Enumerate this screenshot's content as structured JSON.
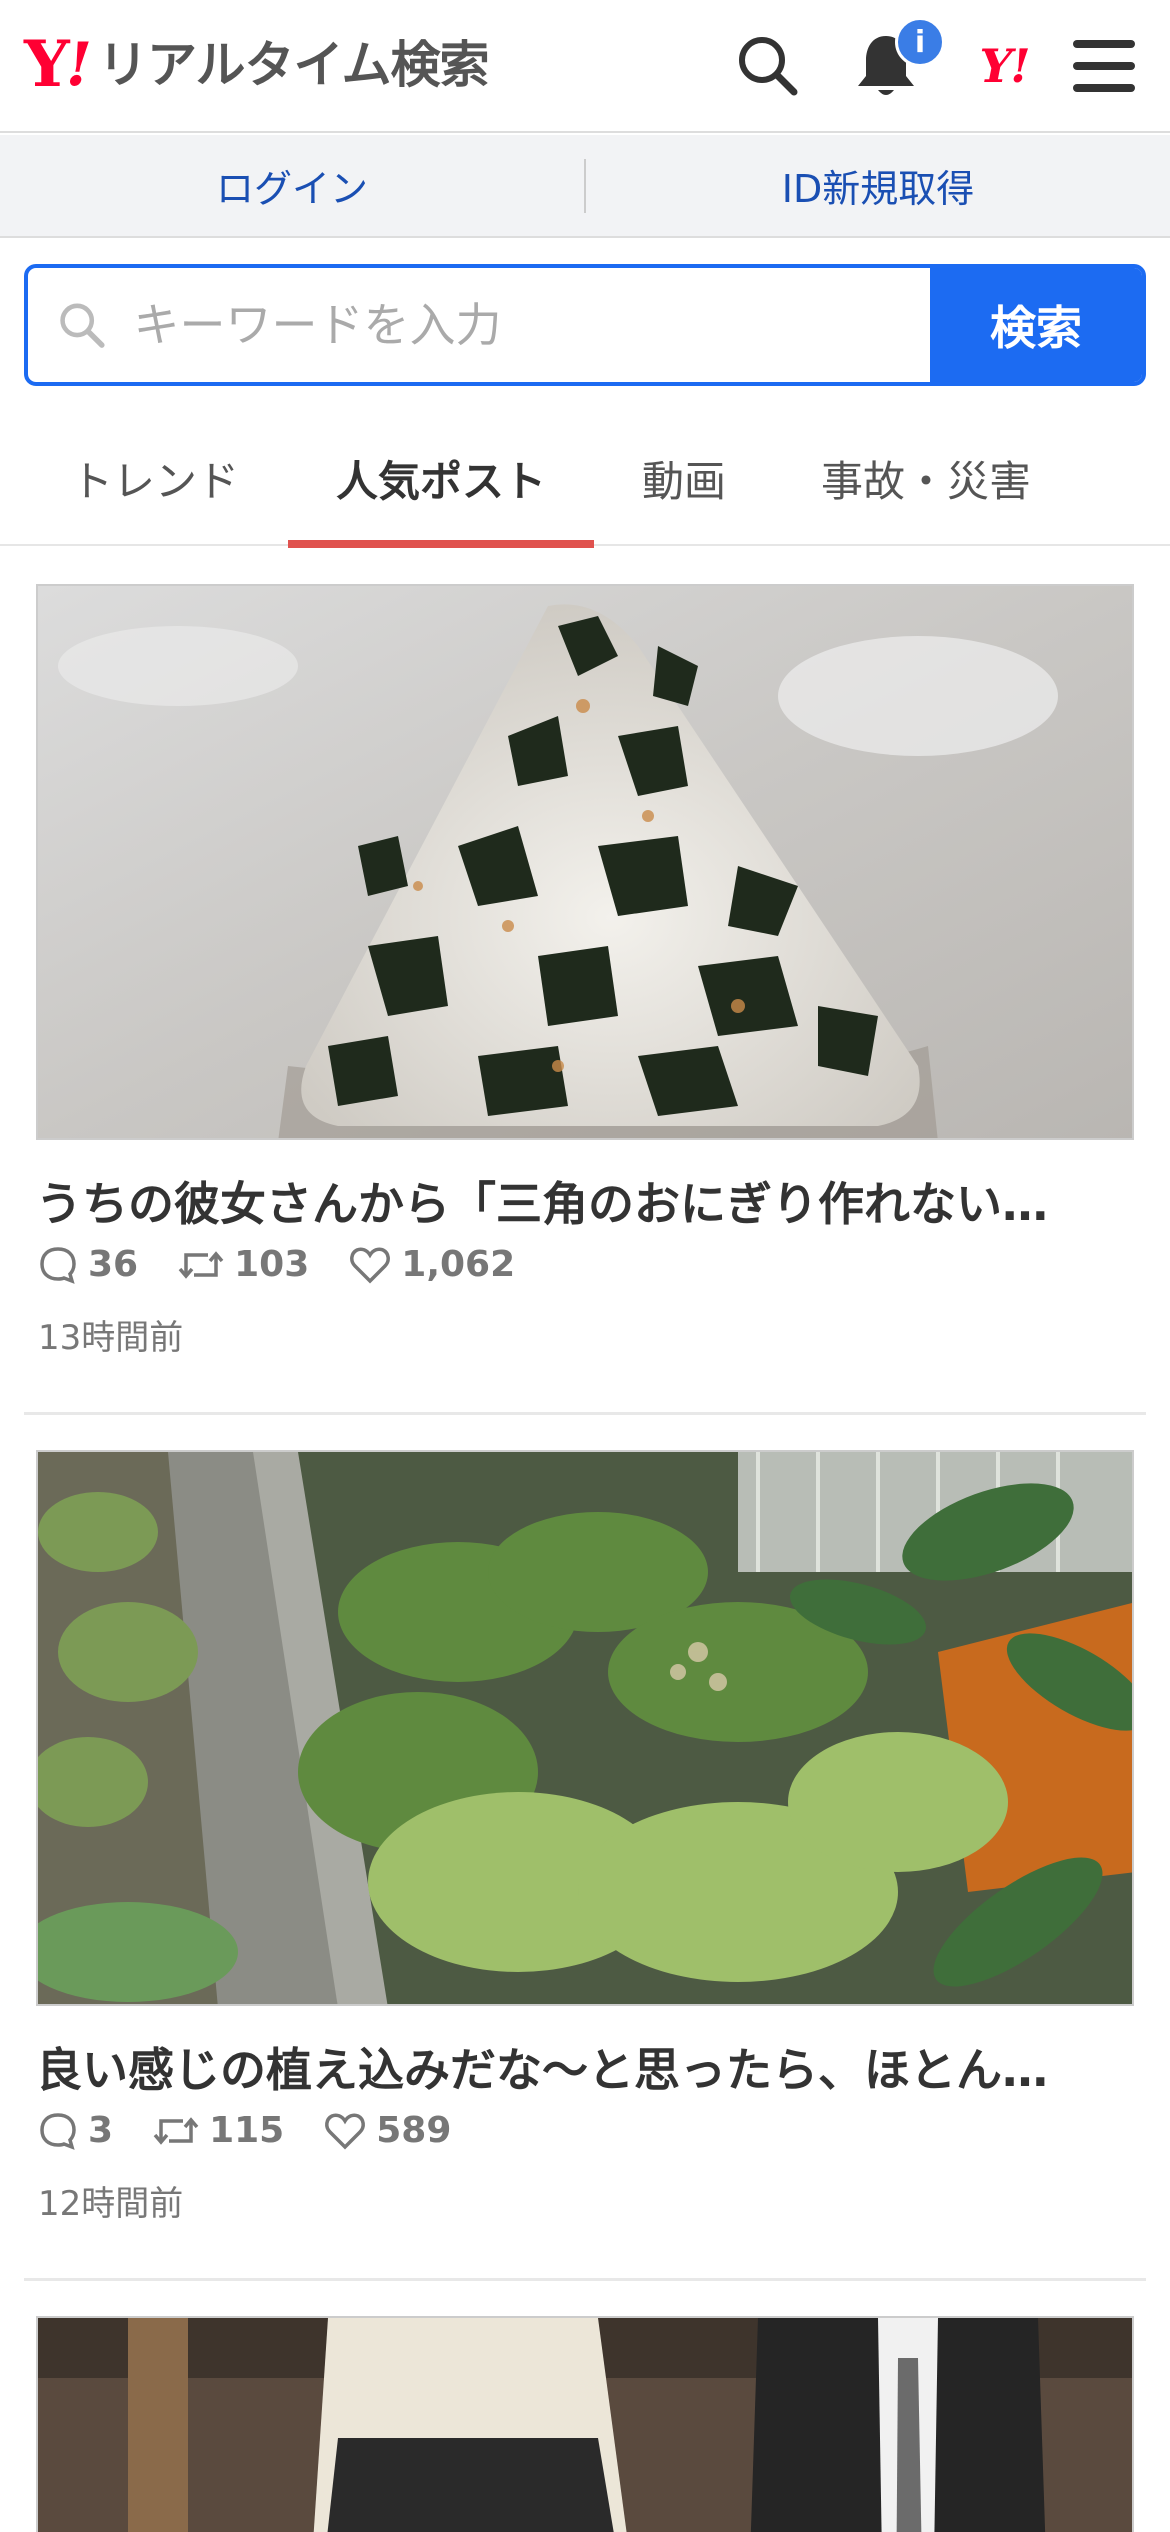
{
  "header": {
    "logo_y": "Y",
    "logo_ex": "!",
    "logo_text": "リアルタイム検索",
    "notification_count": "i",
    "yjapan_mark": "Y!",
    "icons": [
      "search-icon",
      "bell-icon",
      "yahoo-japan-icon",
      "menu-icon"
    ]
  },
  "account": {
    "login_label": "ログイン",
    "signup_label": "ID新規取得"
  },
  "search": {
    "placeholder": "キーワードを入力",
    "button_label": "検索"
  },
  "tabs": [
    {
      "label": "トレンド",
      "active": false
    },
    {
      "label": "人気ポスト",
      "active": true
    },
    {
      "label": "動画",
      "active": false
    },
    {
      "label": "事故・災害",
      "active": false
    }
  ],
  "posts": [
    {
      "title": "うちの彼女さんから「三角のおにぎり作れない…",
      "replies": "36",
      "reposts": "103",
      "likes": "1,062",
      "time": "13時間前"
    },
    {
      "title": "良い感じの植え込みだな〜と思ったら、ほとん…",
      "replies": "3",
      "reposts": "115",
      "likes": "589",
      "time": "12時間前"
    }
  ],
  "colors": {
    "brand_red": "#ff0033",
    "search_blue": "#1c6bf2",
    "link_blue": "#1a4fb3",
    "tab_underline": "#e0524e",
    "badge_blue": "#3a7de6"
  }
}
